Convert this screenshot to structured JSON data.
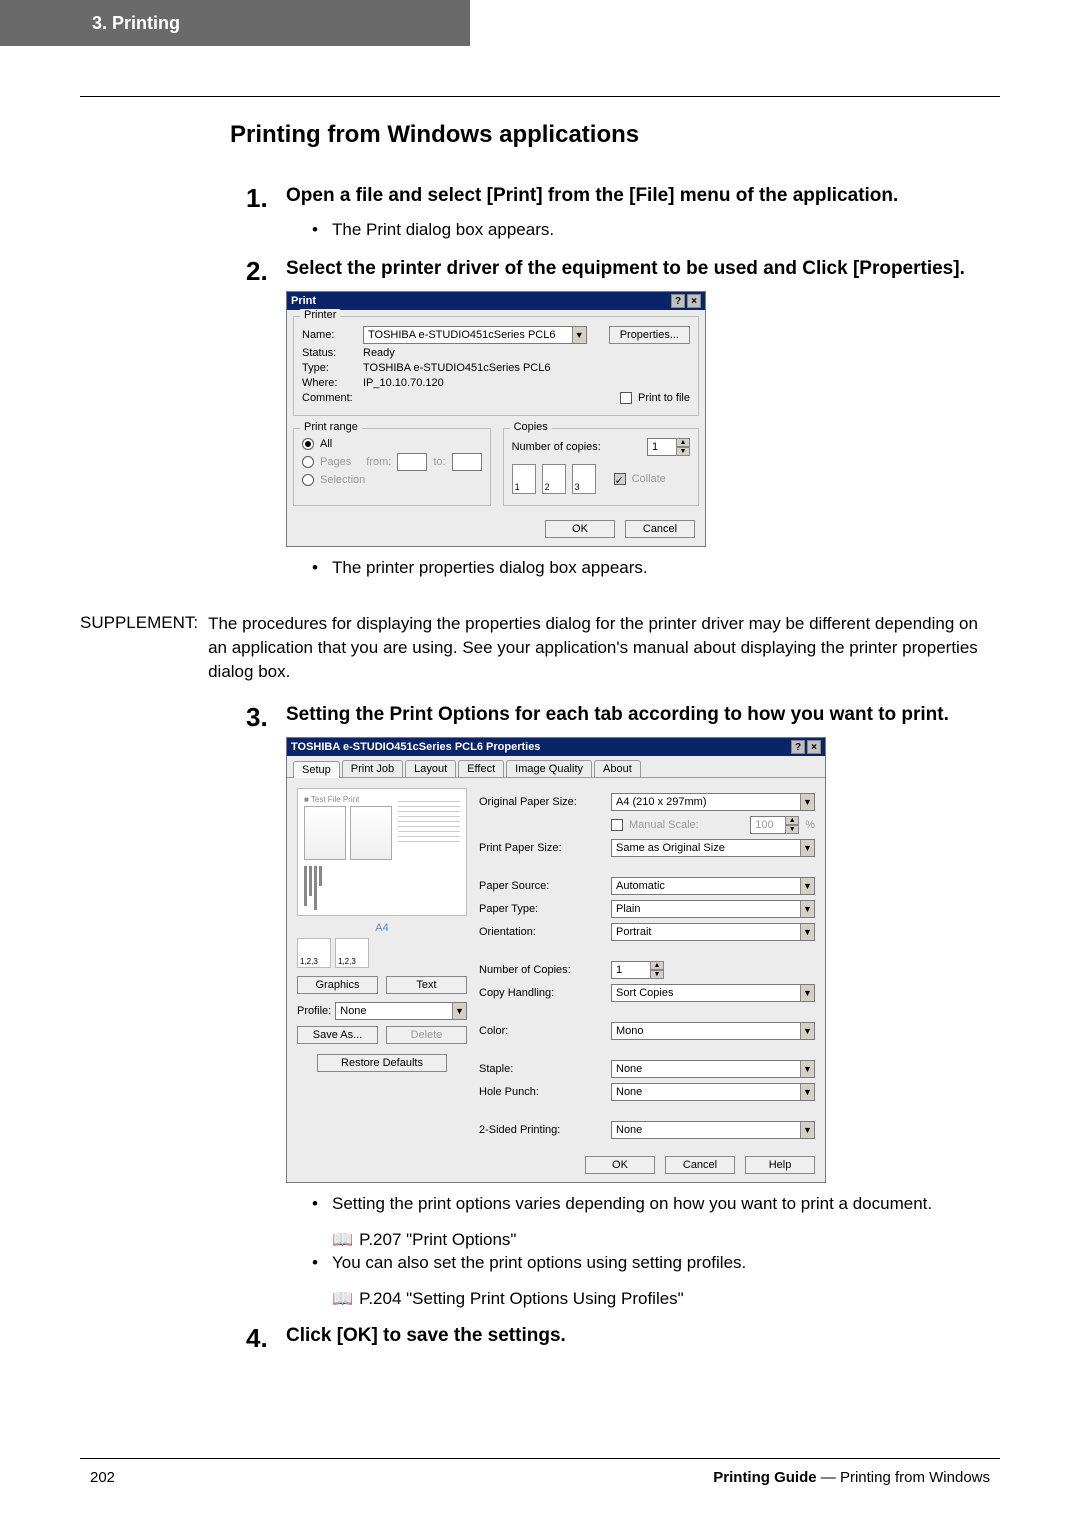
{
  "header": {
    "chapter": "3.  Printing"
  },
  "section": {
    "title": "Printing from Windows applications"
  },
  "steps": {
    "s1": {
      "num": "1.",
      "text": "Open a file and select [Print] from the [File] menu of the application.",
      "bullets": [
        "The Print dialog box appears."
      ]
    },
    "s2": {
      "num": "2.",
      "text": "Select the printer driver of the equipment to be used and Click [Properties].",
      "bullets": [
        "The printer properties dialog box appears."
      ]
    },
    "s3": {
      "num": "3.",
      "text": "Setting the Print Options for each tab according to how you want to print.",
      "bullets_after": [
        "Setting the print options varies depending on how you want to print a document.",
        "You can also set the print options using setting profiles."
      ],
      "sub_after_1": "P.207 \"Print Options\"",
      "sub_after_2": "P.204 \"Setting Print Options Using Profiles\""
    },
    "s4": {
      "num": "4.",
      "text": "Click [OK] to save the settings."
    }
  },
  "supplement": {
    "label": "SUPPLEMENT:",
    "text": "The procedures for displaying the properties dialog for the printer driver may be different depending on an application that you are using. See your application's manual about displaying the printer properties dialog box."
  },
  "dlg1": {
    "title": "Print",
    "help": "?",
    "close": "×",
    "printer_group": "Printer",
    "name_label": "Name:",
    "name_value": "TOSHIBA e-STUDIO451cSeries PCL6",
    "properties_btn": "Properties...",
    "status_label": "Status:",
    "status_value": "Ready",
    "type_label": "Type:",
    "type_value": "TOSHIBA e-STUDIO451cSeries PCL6",
    "where_label": "Where:",
    "where_value": "IP_10.10.70.120",
    "comment_label": "Comment:",
    "print_to_file": "Print to file",
    "range_group": "Print range",
    "all": "All",
    "pages": "Pages",
    "from": "from:",
    "to": "to:",
    "selection": "Selection",
    "copies_group": "Copies",
    "num_copies": "Number of copies:",
    "copies_val": "1",
    "collate": "Collate",
    "ok": "OK",
    "cancel": "Cancel"
  },
  "dlg2": {
    "title": "TOSHIBA e-STUDIO451cSeries PCL6 Properties",
    "tabs": [
      "Setup",
      "Print Job",
      "Layout",
      "Effect",
      "Image Quality",
      "About"
    ],
    "note": "A4",
    "sort_label": "1,2,3   1,2,3",
    "graphics": "Graphics",
    "text": "Text",
    "profile_label": "Profile:",
    "profile_value": "None",
    "save_as": "Save As...",
    "delete": "Delete",
    "restore": "Restore Defaults",
    "rows": {
      "orig_size_l": "Original Paper Size:",
      "orig_size_v": "A4 (210 x 297mm)",
      "manual_scale": "Manual Scale:",
      "manual_scale_v": "100",
      "pct": "%",
      "print_size_l": "Print Paper Size:",
      "print_size_v": "Same as Original Size",
      "source_l": "Paper Source:",
      "source_v": "Automatic",
      "ptype_l": "Paper Type:",
      "ptype_v": "Plain",
      "orient_l": "Orientation:",
      "orient_v": "Portrait",
      "ncopies_l": "Number of Copies:",
      "ncopies_v": "1",
      "copyh_l": "Copy Handling:",
      "copyh_v": "Sort Copies",
      "color_l": "Color:",
      "color_v": "Mono",
      "staple_l": "Staple:",
      "staple_v": "None",
      "punch_l": "Hole Punch:",
      "punch_v": "None",
      "duplex_l": "2-Sided Printing:",
      "duplex_v": "None"
    },
    "ok": "OK",
    "cancel": "Cancel",
    "help_btn": "Help",
    "help": "?",
    "close": "×"
  },
  "footer": {
    "page": "202",
    "right_b": "Printing Guide",
    "right_n": " — Printing from Windows"
  }
}
